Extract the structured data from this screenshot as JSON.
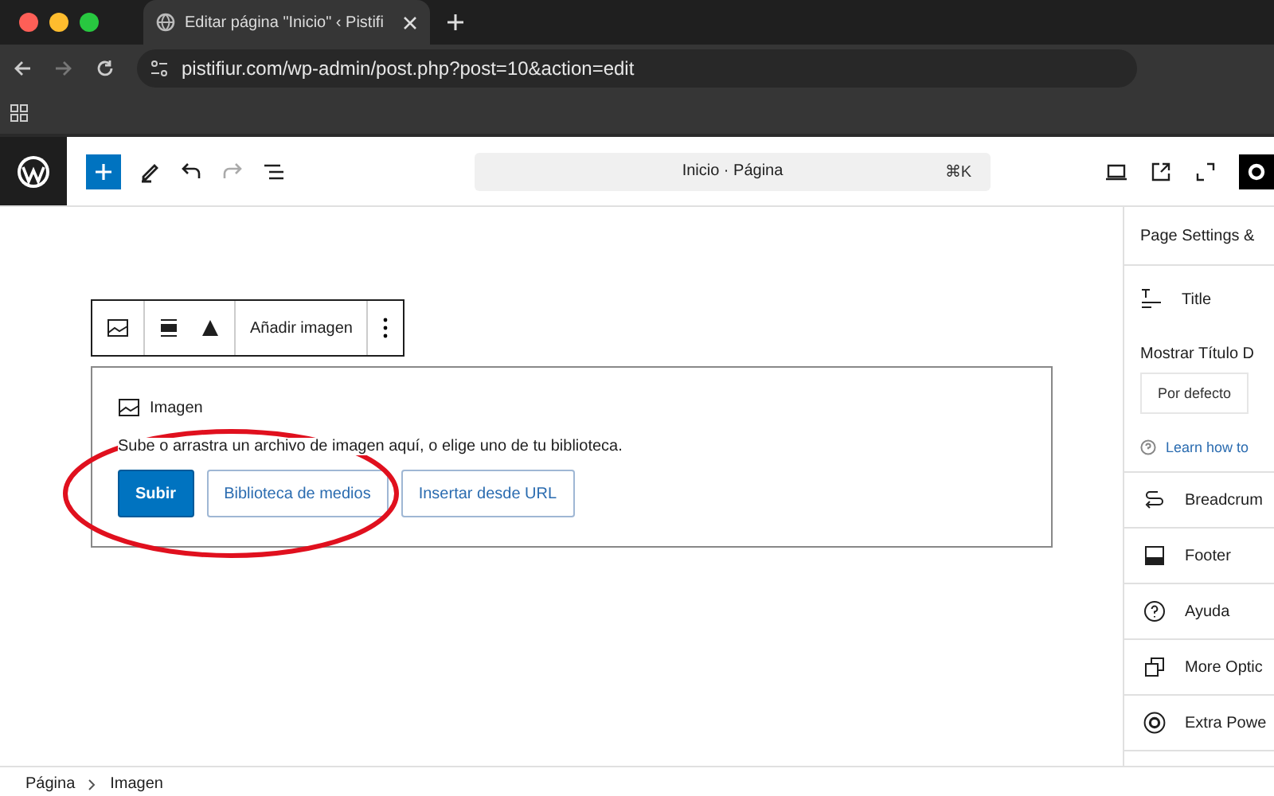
{
  "browser": {
    "tab": {
      "title": "Editar página \"Inicio\" ‹ Pistifi",
      "selected": true
    },
    "url": "pistifiur.com/wp-admin/post.php?post=10&action=edit"
  },
  "editor_bar": {
    "document_title": "Inicio · Página",
    "shortcut": "⌘K"
  },
  "block_toolbar": {
    "action": "Añadir imagen"
  },
  "image_block": {
    "label": "Imagen",
    "instructions": "Sube o arrastra un archivo de imagen aquí, o elige uno de tu biblioteca.",
    "buttons": [
      {
        "label": "Subir",
        "kind": "primary"
      },
      {
        "label": "Biblioteca de medios",
        "kind": "secondary"
      },
      {
        "label": "Insertar desde URL",
        "kind": "secondary"
      }
    ]
  },
  "sidebar": {
    "header": "Page Settings &",
    "title_panel": {
      "label": "Title",
      "field_label": "Mostrar Título D",
      "option": "Por defecto",
      "help_link": "Learn how to"
    },
    "panels": [
      {
        "label": "Breadcrum"
      },
      {
        "label": "Footer"
      },
      {
        "label": "Ayuda"
      },
      {
        "label": "More Optic"
      },
      {
        "label": "Extra Powe"
      }
    ]
  },
  "breadcrumbs": [
    "Página",
    "Imagen"
  ]
}
